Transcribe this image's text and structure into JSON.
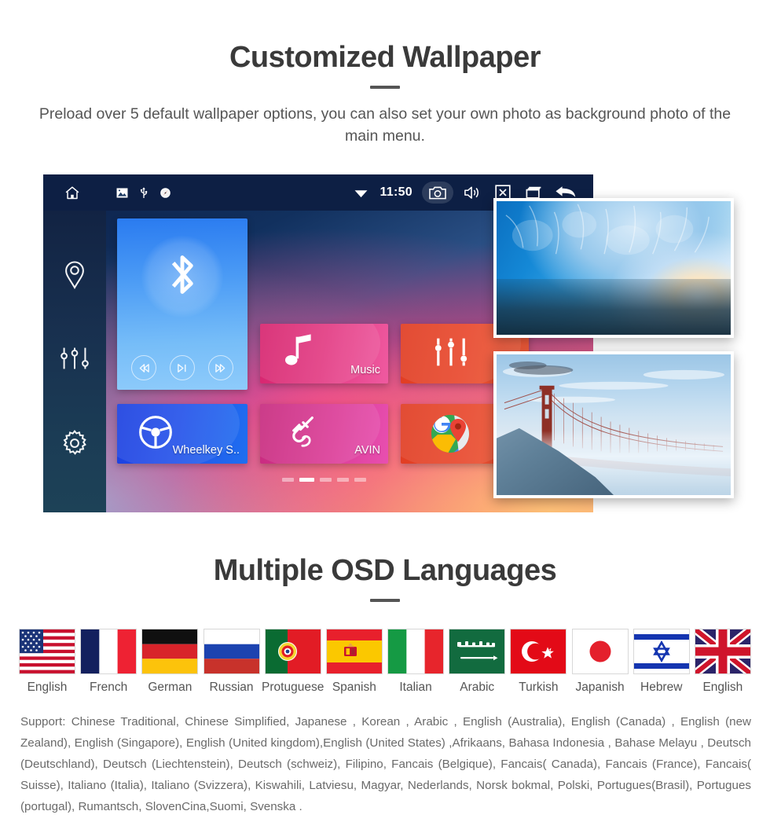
{
  "wallpaper_section": {
    "title": "Customized Wallpaper",
    "subtitle": "Preload over 5 default wallpaper options, you can also set your own photo as background photo of the main menu."
  },
  "head_unit": {
    "status_bar": {
      "left_icons": [
        "home-icon",
        "gallery-icon",
        "usb-icon",
        "compass-icon"
      ],
      "wifi_icon": "wifi-icon",
      "time": "11:50",
      "right_icons": [
        "camera-icon",
        "volume-icon",
        "close-x-icon",
        "recent-apps-icon",
        "back-arrow-icon"
      ]
    },
    "sidebar": {
      "items": [
        {
          "name": "navigation",
          "icon": "location-pin-icon"
        },
        {
          "name": "equalizer",
          "icon": "equalizer-icon"
        },
        {
          "name": "settings",
          "icon": "gear-icon"
        }
      ]
    },
    "tiles": [
      {
        "id": "bluetooth",
        "label": "",
        "icon": "bluetooth-icon",
        "controls": [
          "previous-icon",
          "play-pause-icon",
          "next-icon"
        ]
      },
      {
        "id": "wheelkey",
        "label": "Wheelkey S..",
        "icon": "steering-wheel-icon"
      },
      {
        "id": "music",
        "label": "Music",
        "icon": "music-note-icon"
      },
      {
        "id": "avin",
        "label": "AVIN",
        "icon": "aux-cable-icon"
      },
      {
        "id": "equalizer",
        "label": "",
        "icon": "equalizer-icon"
      },
      {
        "id": "maps",
        "label": "",
        "icon": "google-maps-icon"
      }
    ],
    "page_indicator": {
      "count": 5,
      "active": 2
    }
  },
  "wallpaper_previews": [
    {
      "id": "ice-cave",
      "alt": "Blue ice cave wallpaper preview"
    },
    {
      "id": "golden-gate-bridge",
      "alt": "Golden Gate Bridge in fog wallpaper preview"
    }
  ],
  "languages_section": {
    "title": "Multiple OSD Languages",
    "flags": [
      {
        "name": "English",
        "flag": "flag-usa"
      },
      {
        "name": "French",
        "flag": "flag-france"
      },
      {
        "name": "German",
        "flag": "flag-germany"
      },
      {
        "name": "Russian",
        "flag": "flag-russia"
      },
      {
        "name": "Protuguese",
        "flag": "flag-portugal"
      },
      {
        "name": "Spanish",
        "flag": "flag-spain"
      },
      {
        "name": "Italian",
        "flag": "flag-italy"
      },
      {
        "name": "Arabic",
        "flag": "flag-saudi-arabia"
      },
      {
        "name": "Turkish",
        "flag": "flag-turkey"
      },
      {
        "name": "Japanish",
        "flag": "flag-japan"
      },
      {
        "name": "Hebrew",
        "flag": "flag-israel"
      },
      {
        "name": "English",
        "flag": "flag-uk"
      }
    ],
    "support_text": "Support: Chinese Traditional, Chinese Simplified, Japanese , Korean , Arabic , English (Australia), English (Canada) , English (new Zealand), English (Singapore), English (United kingdom),English (United States) ,Afrikaans, Bahasa Indonesia , Bahase Melayu , Deutsch (Deutschland), Deutsch (Liechtenstein), Deutsch (schweiz), Filipino, Fancais (Belgique), Fancais( Canada), Fancais (France), Fancais( Suisse), Italiano (Italia), Italiano (Svizzera), Kiswahili, Latviesu, Magyar, Nederlands, Norsk bokmal, Polski, Portugues(Brasil), Portugues (portugal), Rumantsch, SlovenCina,Suomi, Svenska ."
  },
  "colors": {
    "heading": "#3a3a3a",
    "body_text": "#555555",
    "statusbar_bg": "#0d1f44",
    "tile_blue": "#2a7bf0",
    "tile_pink": "#d6246e",
    "tile_red": "#e03c22"
  }
}
